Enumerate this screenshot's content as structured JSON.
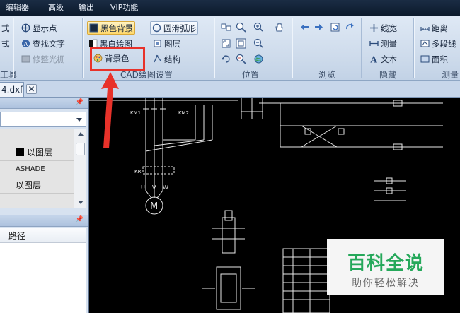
{
  "menubar": {
    "items": [
      "编辑器",
      "高级",
      "输出",
      "VIP功能"
    ]
  },
  "ribbon": {
    "partial_left": {
      "row1": "式",
      "row2": "式",
      "label": "工具"
    },
    "tools": {
      "show_points": "显示点",
      "find_text": "查找文字",
      "trim_raster": "修整光栅"
    },
    "cad_settings": {
      "black_background": "黑色背景",
      "smooth_arc": "圆滑弧形",
      "bw_drawing": "黑白绘图",
      "layers": "图层",
      "background_color": "背景色",
      "structure": "结构",
      "label": "CAD绘图设置"
    },
    "position": {
      "label": "位置"
    },
    "browse": {
      "label": "浏览"
    },
    "hide": {
      "line_width": "线宽",
      "measure": "测量",
      "text": "文本",
      "label": "隐藏"
    },
    "measure_group": {
      "distance": "距离",
      "polyline": "多段线",
      "area": "面积",
      "label": "测量"
    }
  },
  "document_tab": {
    "title": "4.dxf"
  },
  "properties": {
    "rows": [
      {
        "value": "以图层",
        "swatch": "#000000"
      },
      {
        "value": "ASHADE"
      },
      {
        "value": "以图层"
      }
    ]
  },
  "list_panel": {
    "column_header": "路径"
  },
  "drawing": {
    "labels": {
      "km1": "KM1",
      "km2": "KM2",
      "kr": "KR",
      "phases": [
        "U",
        "V",
        "W"
      ],
      "motor": "M"
    }
  },
  "watermark": {
    "title": "百科全说",
    "subtitle": "助你轻松解决"
  },
  "colors": {
    "accent_red": "#e8322a",
    "watermark_green": "#25a85a",
    "highlight": "#ffd86b"
  }
}
